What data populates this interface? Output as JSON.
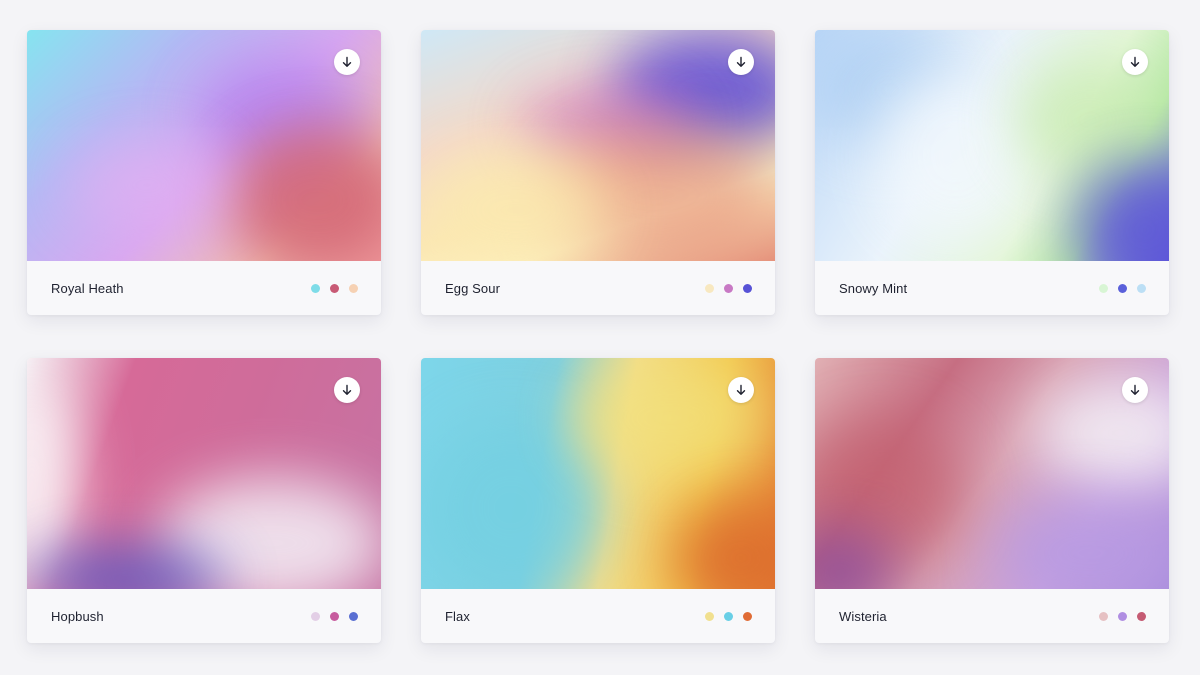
{
  "download_icon": "arrow-down-icon",
  "cards": [
    {
      "name": "Royal Heath",
      "colors": [
        "#7edce8",
        "#c85a75",
        "#f6d1b3"
      ]
    },
    {
      "name": "Egg Sour",
      "colors": [
        "#f8e8c0",
        "#c879c4",
        "#5752d6"
      ]
    },
    {
      "name": "Snowy Mint",
      "colors": [
        "#d8f5d4",
        "#5a60da",
        "#bcdff5"
      ]
    },
    {
      "name": "Hopbush",
      "colors": [
        "#e3cfe6",
        "#c75c9e",
        "#5a6fd2"
      ]
    },
    {
      "name": "Flax",
      "colors": [
        "#f1e08f",
        "#69cfe6",
        "#e06c35"
      ]
    },
    {
      "name": "Wisteria",
      "colors": [
        "#e6c1c3",
        "#b08ee2",
        "#c55b73"
      ]
    }
  ]
}
